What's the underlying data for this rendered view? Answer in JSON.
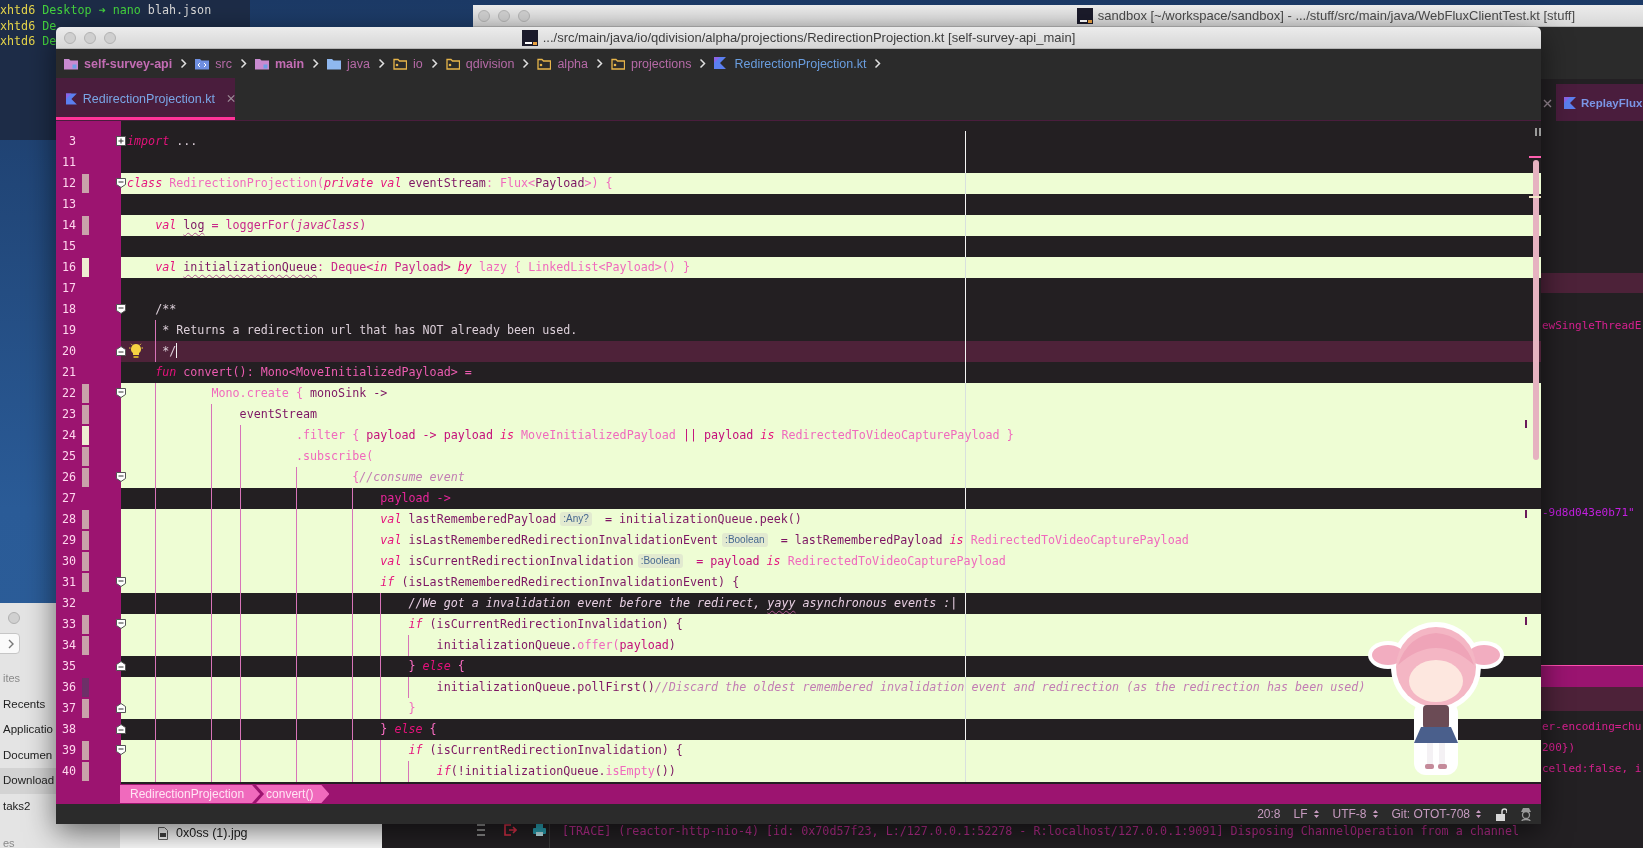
{
  "terminal": {
    "lines": [
      {
        "segments": [
          {
            "kind": "user",
            "text": "xhtd6"
          },
          {
            "kind": "path",
            "text": "Desktop"
          },
          {
            "kind": "prompt",
            "text": "➜"
          },
          {
            "kind": "cmd",
            "text": "nano"
          },
          {
            "kind": "arg",
            "text": "blah.json"
          }
        ]
      },
      {
        "segments": [
          {
            "kind": "user",
            "text": "xhtd6"
          },
          {
            "kind": "path",
            "text": "De"
          }
        ]
      },
      {
        "segments": [
          {
            "kind": "user",
            "text": "xhtd6"
          },
          {
            "kind": "path",
            "text": "De"
          }
        ]
      }
    ]
  },
  "back_window": {
    "title": "sandbox [~/workspace/sandbox] - .../stuff/src/main/java/WebFluxClientTest.kt [stuff]",
    "tab": {
      "label": "ReplayFlux",
      "selected": true
    },
    "snippets": [
      {
        "text": "ewSingleThreadE",
        "kind": "code"
      },
      {
        "text": "-9d8d043e0b71\"",
        "kind": "string"
      },
      {
        "text": "er-encoding=chu",
        "kind": "code"
      },
      {
        "text": "200})",
        "kind": "code"
      },
      {
        "text": "celled:false, i",
        "kind": "code"
      }
    ],
    "console_line": "[TRACE] (reactor-http-nio-4) [id: 0x70d57f23, L:/127.0.0.1:52278 - R:localhost/127.0.0.1:9091] Disposing ChannelOperation from a channel"
  },
  "finder": {
    "sidebar": [
      {
        "label": "ites",
        "kind": "heading",
        "selected": false
      },
      {
        "label": "Recents",
        "kind": "item",
        "selected": false
      },
      {
        "label": "Applicatio",
        "kind": "item",
        "selected": false
      },
      {
        "label": "Documen",
        "kind": "item",
        "selected": false
      },
      {
        "label": "Download",
        "kind": "item",
        "selected": true
      },
      {
        "label": "taks2",
        "kind": "item",
        "selected": false
      },
      {
        "label": "es",
        "kind": "heading",
        "selected": false
      }
    ],
    "files": [
      {
        "name": "0x0ss (1).jpg"
      }
    ]
  },
  "main_window": {
    "title": ".../src/main/java/io/qdivision/alpha/projections/RedirectionProjection.kt [self-survey-api_main]",
    "breadcrumbs": [
      {
        "label": "self-survey-api",
        "kind": "module"
      },
      {
        "label": "src",
        "kind": "source"
      },
      {
        "label": "main",
        "kind": "module"
      },
      {
        "label": "java",
        "kind": "folder"
      },
      {
        "label": "io",
        "kind": "package"
      },
      {
        "label": "qdivision",
        "kind": "package"
      },
      {
        "label": "alpha",
        "kind": "package"
      },
      {
        "label": "projections",
        "kind": "package"
      },
      {
        "label": "RedirectionProjection.kt",
        "kind": "kotlin"
      }
    ],
    "tabs": [
      {
        "label": "RedirectionProjection.kt",
        "selected": true
      }
    ],
    "editor": {
      "lines": [
        {
          "number": "3",
          "kind": "collapsed",
          "highlighted": false,
          "current": false,
          "changed": false,
          "bulb": false,
          "segments": [
            {
              "kind": "kw",
              "text": "import"
            },
            {
              "kind": "plain",
              "text": " ..."
            }
          ]
        },
        {
          "number": "11",
          "kind": "plain",
          "highlighted": false,
          "current": false,
          "changed": false,
          "bulb": false
        },
        {
          "number": "12",
          "kind": "opener",
          "highlighted": true,
          "current": false,
          "changed": true,
          "color": "#c9a2aa",
          "bulb": false,
          "segments": [
            {
              "kind": "kw",
              "text": "class"
            },
            {
              "kind": "type",
              "text": " RedirectionProjection("
            },
            {
              "kind": "kw",
              "text": "private val"
            },
            {
              "kind": "plain",
              "text": " eventStream"
            },
            {
              "kind": "type",
              "text": ": Flux<"
            },
            {
              "kind": "plain",
              "text": "Payload"
            },
            {
              "kind": "type",
              "text": ">) {"
            }
          ]
        },
        {
          "number": "13",
          "kind": "plain",
          "highlighted": false,
          "current": false,
          "changed": false,
          "bulb": false
        },
        {
          "number": "14",
          "kind": "plain",
          "highlighted": true,
          "current": false,
          "changed": true,
          "color": "#c9a2aa",
          "bulb": false,
          "segments": [
            {
              "kind": "kw",
              "text": "    val "
            },
            {
              "kind": "typo",
              "text": "log"
            },
            {
              "kind": "fn",
              "text": " = loggerFor("
            },
            {
              "kind": "italic",
              "text": "javaClass"
            },
            {
              "kind": "fn",
              "text": ")"
            }
          ]
        },
        {
          "number": "15",
          "kind": "plain",
          "highlighted": false,
          "current": false,
          "changed": false,
          "bulb": false
        },
        {
          "number": "16",
          "kind": "plain",
          "highlighted": true,
          "current": false,
          "changed": true,
          "color": "#eeedd2",
          "bulb": false,
          "segments": [
            {
              "kind": "kw",
              "text": "    val "
            },
            {
              "kind": "typo",
              "text": "initializationQueue"
            },
            {
              "kind": "fn",
              "text": ": Deque<"
            },
            {
              "kind": "kw",
              "text": "in"
            },
            {
              "kind": "fn",
              "text": " Payload> "
            },
            {
              "kind": "kw",
              "text": "by"
            },
            {
              "kind": "type",
              "text": " lazy { LinkedList<Payload>() }"
            }
          ]
        },
        {
          "number": "17",
          "kind": "plain",
          "highlighted": false,
          "current": false,
          "changed": false,
          "bulb": false
        },
        {
          "number": "18",
          "kind": "opener",
          "highlighted": false,
          "current": false,
          "changed": false,
          "bulb": false,
          "segments": [
            {
              "kind": "doc",
              "text": "    /**"
            }
          ]
        },
        {
          "number": "19",
          "kind": "plain",
          "highlighted": false,
          "current": false,
          "changed": false,
          "bulb": false,
          "segments": [
            {
              "kind": "doc",
              "text": "     * Returns a redirection url that has NOT already been used."
            }
          ]
        },
        {
          "number": "20",
          "kind": "closer",
          "highlighted": false,
          "current": true,
          "changed": false,
          "bulb": true,
          "segments": [
            {
              "kind": "doc",
              "text": "     */"
            }
          ]
        },
        {
          "number": "21",
          "kind": "plain",
          "highlighted": false,
          "current": false,
          "changed": false,
          "bulb": false,
          "segments": [
            {
              "kind": "kw",
              "text": "    fun"
            },
            {
              "kind": "fn",
              "text": " convert(): Mono<MoveInitializedPayload> ="
            }
          ]
        },
        {
          "number": "22",
          "kind": "opener",
          "highlighted": true,
          "current": false,
          "changed": true,
          "color": "#c9a2aa",
          "bulb": false,
          "segments": [
            {
              "kind": "type",
              "text": "            Mono.create { "
            },
            {
              "kind": "plain",
              "text": "monoSink ->"
            }
          ]
        },
        {
          "number": "23",
          "kind": "plain",
          "highlighted": true,
          "current": false,
          "changed": true,
          "color": "#c9a2aa",
          "bulb": false,
          "segments": [
            {
              "kind": "plain",
              "text": "                eventStream"
            }
          ]
        },
        {
          "number": "24",
          "kind": "plain",
          "highlighted": true,
          "current": false,
          "changed": true,
          "color": "#eeedd2",
          "bulb": false,
          "segments": [
            {
              "kind": "type",
              "text": "                        .filter { "
            },
            {
              "kind": "param",
              "text": "payload -> payload "
            },
            {
              "kind": "kw",
              "text": "is"
            },
            {
              "kind": "type",
              "text": " MoveInitializedPayload "
            },
            {
              "kind": "param",
              "text": "|| payload "
            },
            {
              "kind": "kw",
              "text": "is"
            },
            {
              "kind": "type",
              "text": " RedirectedToVideoCapturePayload }"
            }
          ]
        },
        {
          "number": "25",
          "kind": "plain",
          "highlighted": true,
          "current": false,
          "changed": true,
          "color": "#c9a2aa",
          "bulb": false,
          "segments": [
            {
              "kind": "type",
              "text": "                        .subscribe("
            }
          ]
        },
        {
          "number": "26",
          "kind": "opener",
          "highlighted": true,
          "current": false,
          "changed": true,
          "color": "#c9a2aa",
          "bulb": false,
          "segments": [
            {
              "kind": "type",
              "text": "                                {"
            },
            {
              "kind": "comment",
              "text": "//consume event"
            }
          ]
        },
        {
          "number": "27",
          "kind": "plain",
          "highlighted": false,
          "current": false,
          "changed": false,
          "bulb": false,
          "segments": [
            {
              "kind": "param",
              "text": "                                    payload ->"
            }
          ]
        },
        {
          "number": "28",
          "kind": "plain",
          "highlighted": true,
          "current": false,
          "changed": true,
          "color": "#c9a2aa",
          "bulb": false,
          "segments": [
            {
              "kind": "kw",
              "text": "                                    val"
            },
            {
              "kind": "plain",
              "text": " lastRememberedPayload"
            },
            {
              "kind": "hint",
              "text": ":Any?"
            },
            {
              "kind": "plain",
              "text": " = initializationQueue.peek()"
            }
          ]
        },
        {
          "number": "29",
          "kind": "plain",
          "highlighted": true,
          "current": false,
          "changed": true,
          "color": "#c9a2aa",
          "bulb": false,
          "segments": [
            {
              "kind": "kw",
              "text": "                                    val"
            },
            {
              "kind": "plain",
              "text": " isLastRememberedRedirectionInvalidationEvent"
            },
            {
              "kind": "hint",
              "text": ":Boolean"
            },
            {
              "kind": "plain",
              "text": " = lastRememberedPayload "
            },
            {
              "kind": "kw",
              "text": "is"
            },
            {
              "kind": "type",
              "text": " RedirectedToVideoCapturePayload"
            }
          ]
        },
        {
          "number": "30",
          "kind": "plain",
          "highlighted": true,
          "current": false,
          "changed": true,
          "color": "#c9a2aa",
          "bulb": false,
          "segments": [
            {
              "kind": "kw",
              "text": "                                    val"
            },
            {
              "kind": "plain",
              "text": " isCurrentRedirectionInvalidation"
            },
            {
              "kind": "hint",
              "text": ":Boolean"
            },
            {
              "kind": "param",
              "text": " = payload "
            },
            {
              "kind": "kw",
              "text": "is"
            },
            {
              "kind": "type",
              "text": " RedirectedToVideoCapturePayload"
            }
          ]
        },
        {
          "number": "31",
          "kind": "opener",
          "highlighted": true,
          "current": false,
          "changed": true,
          "color": "#c9a2aa",
          "bulb": false,
          "segments": [
            {
              "kind": "kw",
              "text": "                                    if"
            },
            {
              "kind": "plain",
              "text": " (isLastRememberedRedirectionInvalidationEvent) {"
            }
          ]
        },
        {
          "number": "32",
          "kind": "plain",
          "highlighted": false,
          "current": false,
          "changed": false,
          "bulb": false,
          "segments": [
            {
              "kind": "comment",
              "text": "                                        //We got a invalidation event before the redirect, "
            },
            {
              "kind": "comment-typo",
              "text": "yayy"
            },
            {
              "kind": "comment",
              "text": " asynchronous events :|"
            }
          ]
        },
        {
          "number": "33",
          "kind": "opener",
          "highlighted": true,
          "current": false,
          "changed": true,
          "color": "#c9a2aa",
          "bulb": false,
          "segments": [
            {
              "kind": "kw",
              "text": "                                        if"
            },
            {
              "kind": "plain",
              "text": " (isCurrentRedirectionInvalidation) {"
            }
          ]
        },
        {
          "number": "34",
          "kind": "plain",
          "highlighted": true,
          "current": false,
          "changed": true,
          "color": "#c9a2aa",
          "bulb": false,
          "segments": [
            {
              "kind": "plain",
              "text": "                                            initializationQueue."
            },
            {
              "kind": "type",
              "text": "offer("
            },
            {
              "kind": "param",
              "text": "payload"
            },
            {
              "kind": "plain",
              "text": ")"
            }
          ]
        },
        {
          "number": "35",
          "kind": "closer",
          "highlighted": false,
          "current": false,
          "changed": false,
          "bulb": false,
          "segments": [
            {
              "kind": "type",
              "text": "                                        } "
            },
            {
              "kind": "kw",
              "text": "else"
            },
            {
              "kind": "type",
              "text": " {"
            }
          ]
        },
        {
          "number": "36",
          "kind": "plain",
          "highlighted": true,
          "current": false,
          "changed": true,
          "color": "#6d3068",
          "bulb": false,
          "segments": [
            {
              "kind": "plain",
              "text": "                                            initializationQueue.pollFirst()"
            },
            {
              "kind": "comment",
              "text": "//Discard the oldest remembered invalidation event and redirection (as the redirection has been used)"
            }
          ]
        },
        {
          "number": "37",
          "kind": "closer",
          "highlighted": true,
          "current": false,
          "changed": true,
          "color": "#c9a2aa",
          "bulb": false,
          "segments": [
            {
              "kind": "type",
              "text": "                                        }"
            }
          ]
        },
        {
          "number": "38",
          "kind": "closer",
          "highlighted": false,
          "current": false,
          "changed": false,
          "bulb": false,
          "segments": [
            {
              "kind": "type",
              "text": "                                    } "
            },
            {
              "kind": "kw",
              "text": "else"
            },
            {
              "kind": "type",
              "text": " {"
            }
          ]
        },
        {
          "number": "39",
          "kind": "opener",
          "highlighted": true,
          "current": false,
          "changed": true,
          "color": "#c9a2aa",
          "bulb": false,
          "segments": [
            {
              "kind": "kw",
              "text": "                                        if"
            },
            {
              "kind": "plain",
              "text": " (isCurrentRedirectionInvalidation) {"
            }
          ]
        },
        {
          "number": "40",
          "kind": "plain",
          "highlighted": true,
          "current": false,
          "changed": true,
          "color": "#c9a2aa",
          "bulb": false,
          "segments": [
            {
              "kind": "kw",
              "text": "                                            if"
            },
            {
              "kind": "plain",
              "text": "(!initializationQueue."
            },
            {
              "kind": "type",
              "text": "isEmpty"
            },
            {
              "kind": "plain",
              "text": "())"
            }
          ]
        }
      ]
    },
    "structure_path": [
      "RedirectionProjection",
      "convert()"
    ],
    "status_bar": [
      {
        "label": "20:8",
        "kind": "text"
      },
      {
        "label": "LF",
        "kind": "menu"
      },
      {
        "label": "UTF-8",
        "kind": "menu"
      },
      {
        "label": "Git: OTOT-708",
        "kind": "menu"
      }
    ]
  }
}
